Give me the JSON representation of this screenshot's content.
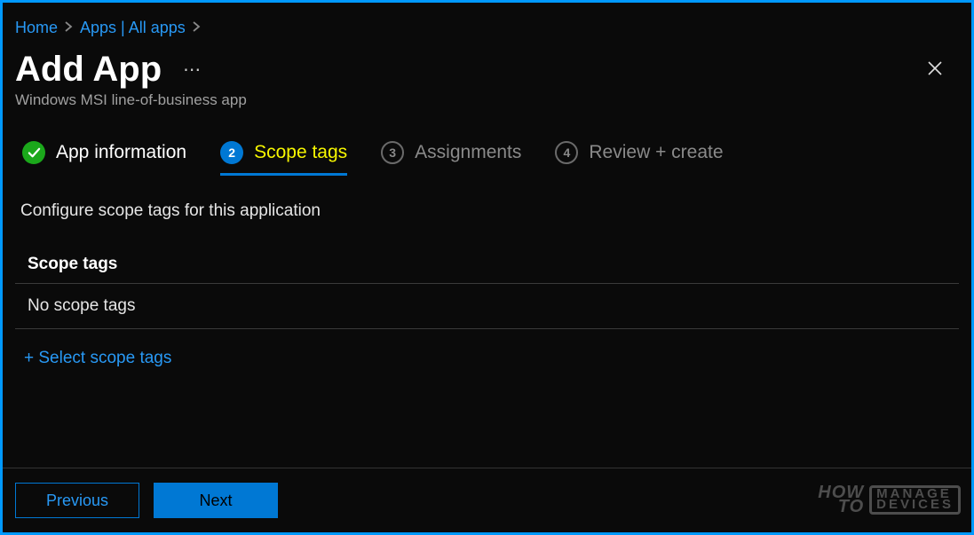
{
  "breadcrumb": {
    "home": "Home",
    "apps": "Apps | All apps"
  },
  "header": {
    "title": "Add App",
    "subtitle": "Windows MSI line-of-business app"
  },
  "steps": {
    "s1": {
      "num": "",
      "label": "App information"
    },
    "s2": {
      "num": "2",
      "label": "Scope tags"
    },
    "s3": {
      "num": "3",
      "label": "Assignments"
    },
    "s4": {
      "num": "4",
      "label": "Review + create"
    }
  },
  "body": {
    "instruction": "Configure scope tags for this application",
    "section_header": "Scope tags",
    "empty_row": "No scope tags",
    "add_link": "+ Select scope tags"
  },
  "footer": {
    "previous": "Previous",
    "next": "Next"
  },
  "watermark": {
    "how": "HOW",
    "to": "TO",
    "manage": "MANAGE",
    "devices": "DEVICES"
  }
}
